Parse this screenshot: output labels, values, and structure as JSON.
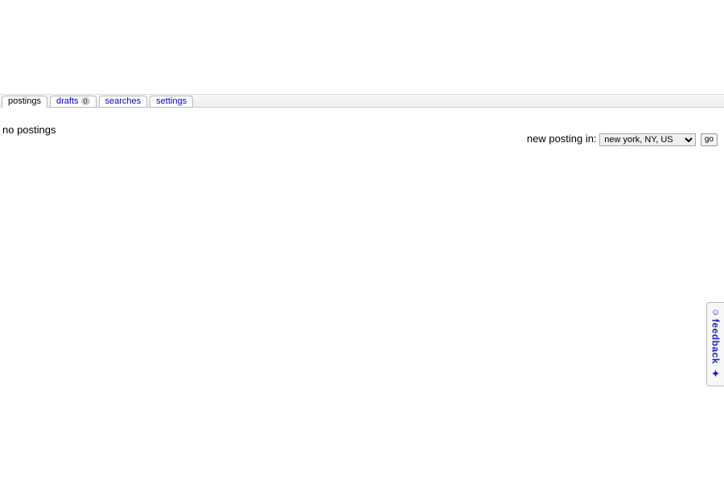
{
  "tabs": {
    "postings": {
      "label": "postings"
    },
    "drafts": {
      "label": "drafts",
      "badge": "0"
    },
    "searches": {
      "label": "searches"
    },
    "settings": {
      "label": "settings"
    }
  },
  "status": {
    "no_postings": "no postings"
  },
  "new_posting": {
    "label": "new posting in:",
    "selected": "new york, NY, US",
    "go": "go"
  },
  "feedback": {
    "label": "feedback"
  }
}
